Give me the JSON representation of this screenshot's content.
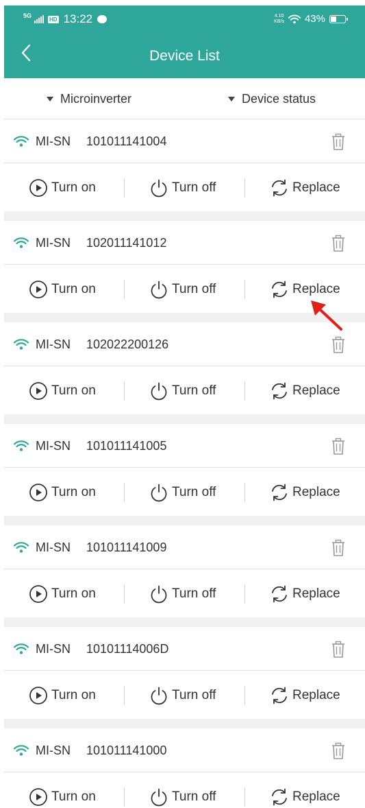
{
  "status_bar": {
    "network": "5G",
    "hd_badge": "HD",
    "time": "13:22",
    "speed_value": "4.10",
    "speed_unit": "KB/s",
    "battery_percent": "43%",
    "battery_level": 0.43
  },
  "header": {
    "title": "Device List",
    "color": "#2fa69a"
  },
  "filters": {
    "type_label": "Microinverter",
    "status_label": "Device status"
  },
  "actions": {
    "turn_on": "Turn on",
    "turn_off": "Turn off",
    "replace": "Replace"
  },
  "devices": [
    {
      "label": "MI-SN",
      "sn": "101011141004"
    },
    {
      "label": "MI-SN",
      "sn": "102011141012"
    },
    {
      "label": "MI-SN",
      "sn": "102022200126"
    },
    {
      "label": "MI-SN",
      "sn": "101011141005"
    },
    {
      "label": "MI-SN",
      "sn": "101011141009"
    },
    {
      "label": "MI-SN",
      "sn": "10101114006D"
    },
    {
      "label": "MI-SN",
      "sn": "101011141000"
    }
  ],
  "icons": {
    "wifi": "wifi-icon",
    "trash": "trash-icon",
    "play": "play-circle-icon",
    "power": "power-icon",
    "replace": "refresh-icon",
    "back": "chevron-left-icon",
    "annotation": "red-arrow-pointer"
  },
  "colors": {
    "accent": "#2fa69a",
    "annotation": "#e0201b"
  }
}
